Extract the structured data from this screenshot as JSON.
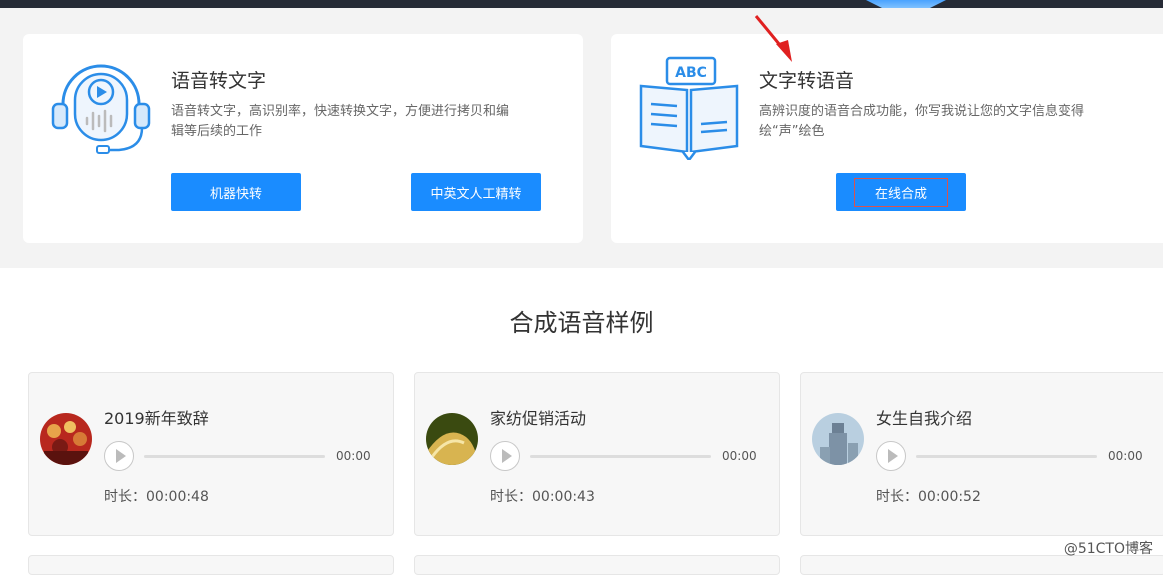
{
  "cards": [
    {
      "title": "语音转文字",
      "desc": "语音转文字，高识别率，快速转换文字，方便进行拷贝和编辑等后续的工作",
      "buttons": [
        "机器快转",
        "中英文人工精转"
      ],
      "icon": "headset-play-icon"
    },
    {
      "title": "文字转语音",
      "desc": "高辨识度的语音合成功能，你写我说让您的文字信息变得绘“声”绘色",
      "buttons": [
        "在线合成"
      ],
      "icon": "book-abc-icon"
    }
  ],
  "section_title": "合成语音样例",
  "samples": [
    {
      "title": "2019新年致辞",
      "time": "00:00",
      "duration": "时长：00:00:48"
    },
    {
      "title": "家纺促销活动",
      "time": "00:00",
      "duration": "时长：00:00:43"
    },
    {
      "title": "女生自我介绍",
      "time": "00:00",
      "duration": "时长：00:00:52"
    }
  ],
  "watermark": "@51CTO博客",
  "colors": {
    "accent": "#1a8cff",
    "topbar": "#262b36",
    "band": "#f3f3f3",
    "highlight": "#d9534f"
  }
}
